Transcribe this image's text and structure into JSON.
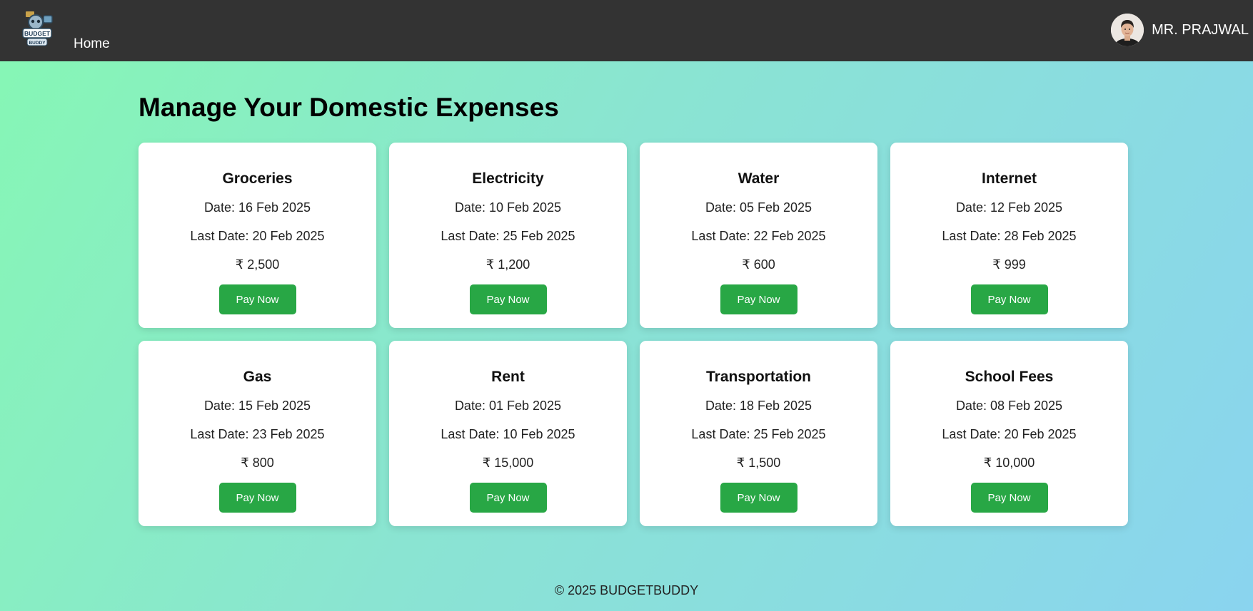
{
  "brand": {
    "logo_text_top": "BUDGET",
    "logo_text_bottom": "BUDDY"
  },
  "nav": {
    "home_label": "Home"
  },
  "user": {
    "name": "MR. PRAJWAL"
  },
  "page": {
    "title": "Manage Your Domestic Expenses"
  },
  "labels": {
    "date_prefix": "Date: ",
    "last_date_prefix": "Last Date: ",
    "currency": "₹ "
  },
  "expenses": [
    {
      "title": "Groceries",
      "date": "Date: 16 Feb 2025",
      "last_date": "Last Date: 20 Feb 2025",
      "amount": "₹ 2,500",
      "button": "Pay Now"
    },
    {
      "title": "Electricity",
      "date": "Date: 10 Feb 2025",
      "last_date": "Last Date: 25 Feb 2025",
      "amount": "₹ 1,200",
      "button": "Pay Now"
    },
    {
      "title": "Water",
      "date": "Date: 05 Feb 2025",
      "last_date": "Last Date: 22 Feb 2025",
      "amount": "₹ 600",
      "button": "Pay Now"
    },
    {
      "title": "Internet",
      "date": "Date: 12 Feb 2025",
      "last_date": "Last Date: 28 Feb 2025",
      "amount": "₹ 999",
      "button": "Pay Now"
    },
    {
      "title": "Gas",
      "date": "Date: 15 Feb 2025",
      "last_date": "Last Date: 23 Feb 2025",
      "amount": "₹ 800",
      "button": "Pay Now"
    },
    {
      "title": "Rent",
      "date": "Date: 01 Feb 2025",
      "last_date": "Last Date: 10 Feb 2025",
      "amount": "₹ 15,000",
      "button": "Pay Now"
    },
    {
      "title": "Transportation",
      "date": "Date: 18 Feb 2025",
      "last_date": "Last Date: 25 Feb 2025",
      "amount": "₹ 1,500",
      "button": "Pay Now"
    },
    {
      "title": "School Fees",
      "date": "Date: 08 Feb 2025",
      "last_date": "Last Date: 20 Feb 2025",
      "amount": "₹ 10,000",
      "button": "Pay Now"
    }
  ],
  "footer": {
    "text": "© 2025 BUDGETBUDDY"
  },
  "colors": {
    "navbar": "#333333",
    "pay_button": "#28a745",
    "gradient_start": "#86f7b4",
    "gradient_end": "#8ad4ef"
  }
}
